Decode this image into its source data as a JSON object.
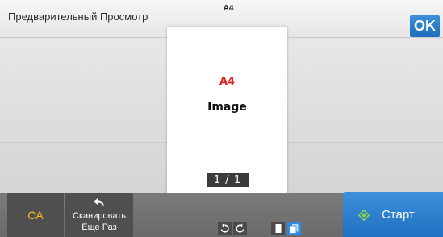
{
  "header": {
    "title": "Предварительный Просмотр",
    "paper_size": "A4",
    "ok_label": "OK"
  },
  "preview": {
    "size_text": "A4",
    "content_text": "Image",
    "page_counter": "1 / 1"
  },
  "toolbar": {
    "ca_label": "CA",
    "rescan_label_line1": "Сканировать",
    "rescan_label_line2": "Еще Раз",
    "rotate_left_icon": "rotate-left-icon",
    "rotate_right_icon": "rotate-right-icon",
    "single_page_view_icon": "single-page-icon",
    "multi_page_view_icon": "multi-page-icon",
    "start_label": "Старт"
  },
  "colors": {
    "accent_blue": "#1f70c1",
    "ca_yellow": "#f0c020",
    "preview_red": "#e0261f"
  }
}
